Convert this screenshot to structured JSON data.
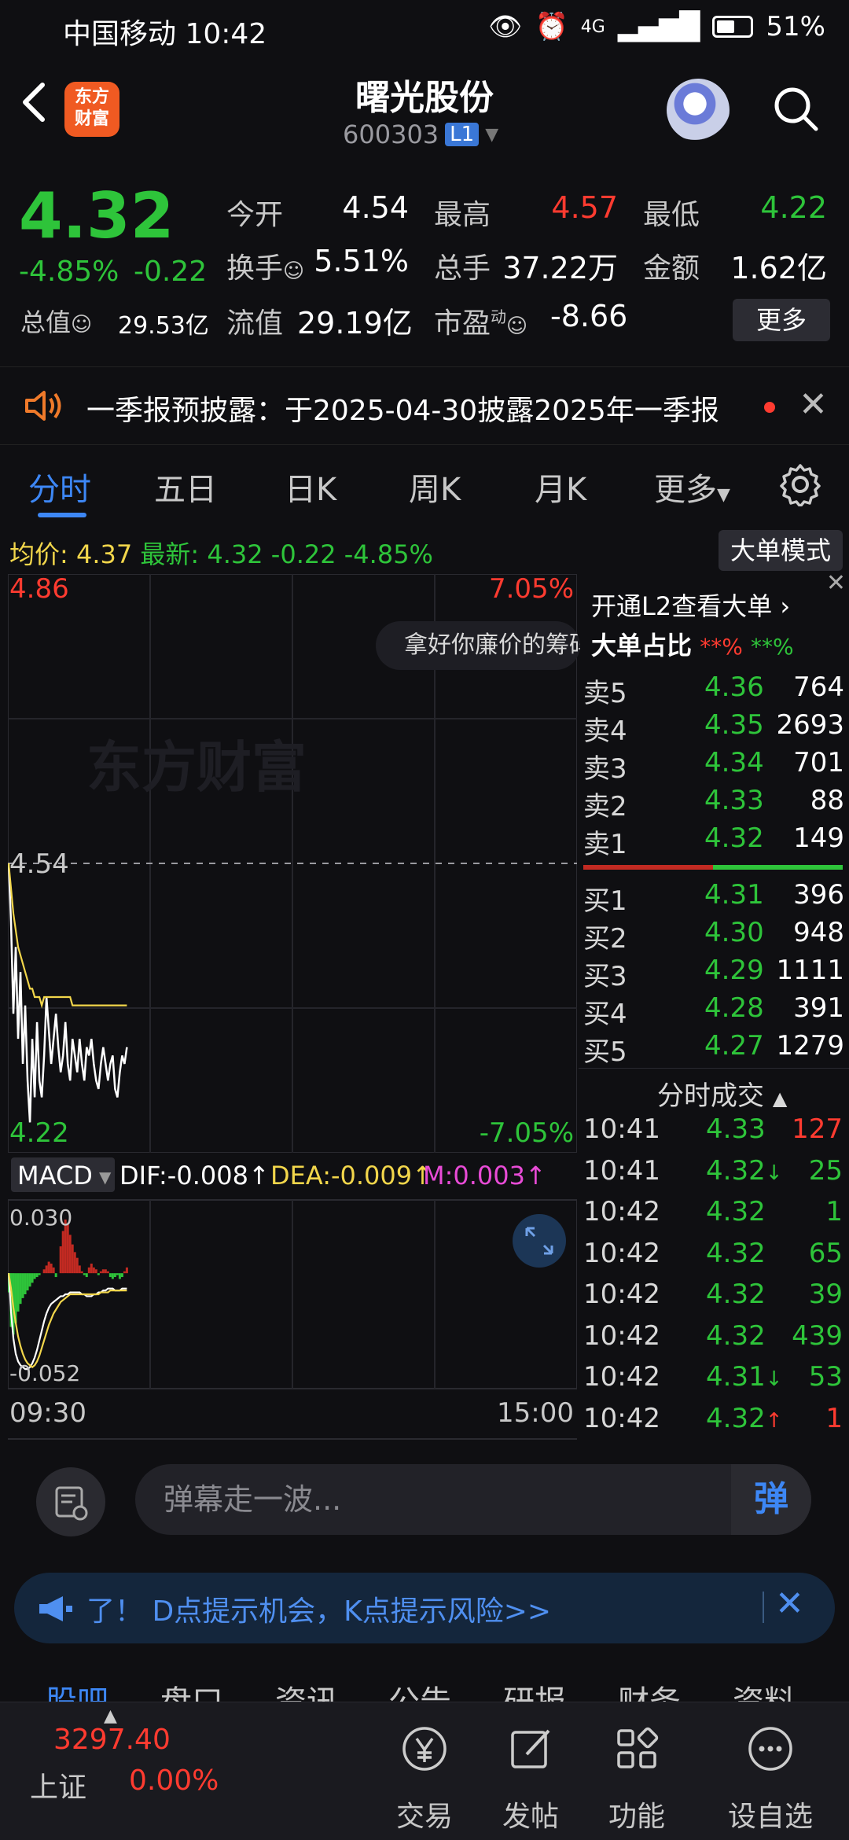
{
  "status_bar": {
    "carrier_time": "中国移动 10:42",
    "network": "4G",
    "battery": "51%"
  },
  "header": {
    "back_label": "<",
    "logo_text": [
      "东方",
      "财富"
    ],
    "title": "曙光股份",
    "code": "600303",
    "level_badge": "L1"
  },
  "quote": {
    "price": "4.32",
    "change_pct": "-4.85%",
    "change": "-0.22",
    "market_value_label": "总值",
    "market_value": "29.53亿",
    "fields": [
      {
        "label": "今开",
        "value": "4.54",
        "color": "#ffffff"
      },
      {
        "label": "最高",
        "value": "4.57",
        "color": "#ff3b30"
      },
      {
        "label": "最低",
        "value": "4.22",
        "color": "#2ec43a"
      },
      {
        "label": "换手",
        "value": "5.51%",
        "color": "#ffffff"
      },
      {
        "label": "总手",
        "value": "37.22万",
        "color": "#ffffff"
      },
      {
        "label": "金额",
        "value": "1.62亿",
        "color": "#ffffff"
      },
      {
        "label": "流值",
        "value": "29.19亿",
        "color": "#ffffff"
      },
      {
        "label": "市盈",
        "superscript": "动",
        "value": "-8.66",
        "color": "#ffffff"
      }
    ],
    "more_label": "更多"
  },
  "notice": {
    "text": "一季报预披露：于2025-04-30披露2025年一季报"
  },
  "tabs": {
    "items": [
      "分时",
      "五日",
      "日K",
      "周K",
      "月K",
      "更多"
    ],
    "active": "分时"
  },
  "info_line": {
    "avg_label": "均价:",
    "avg_value": "4.37",
    "latest_label": "最新:",
    "latest_value": "4.32",
    "latest_change": "-0.22",
    "latest_pct": "-4.85%",
    "big_order_mode": "大单模式"
  },
  "chart_data": [
    {
      "type": "line",
      "ylim": [
        4.22,
        4.86
      ],
      "y_ticks_left": [
        "4.86",
        "4.54",
        "4.22"
      ],
      "y_ticks_right": [
        "7.05%",
        "-7.05%"
      ],
      "x_ticks": [
        "09:30",
        "15:00"
      ],
      "reference_price": 4.54,
      "watermark": "东方财富",
      "series": [
        {
          "values": [
            4.54,
            4.47,
            4.36,
            4.44,
            4.33,
            4.41,
            4.3,
            4.37,
            4.28,
            4.23,
            4.33,
            4.26,
            4.35,
            4.28,
            4.26,
            4.31,
            4.38,
            4.34,
            4.3,
            4.33,
            4.36,
            4.32,
            4.29,
            4.31,
            4.35,
            4.3,
            4.28,
            4.33,
            4.31,
            4.29,
            4.33,
            4.3,
            4.28,
            4.32,
            4.31,
            4.33,
            4.3,
            4.28,
            4.27,
            4.3,
            4.32,
            4.3,
            4.28,
            4.3,
            4.31,
            4.27,
            4.26,
            4.29,
            4.31,
            4.3,
            4.32
          ],
          "color": "#ffffff"
        },
        {
          "values": [
            4.54,
            4.51,
            4.48,
            4.46,
            4.44,
            4.43,
            4.42,
            4.41,
            4.4,
            4.39,
            4.39,
            4.38,
            4.38,
            4.38,
            4.37,
            4.38,
            4.38,
            4.38,
            4.38,
            4.38,
            4.38,
            4.38,
            4.38,
            4.38,
            4.38,
            4.38,
            4.38,
            4.37,
            4.37,
            4.37,
            4.37,
            4.37,
            4.37,
            4.37,
            4.37,
            4.37,
            4.37,
            4.37,
            4.37,
            4.37,
            4.37,
            4.37,
            4.37,
            4.37,
            4.37,
            4.37,
            4.37,
            4.37,
            4.37,
            4.37,
            4.37
          ],
          "color": "#f2d64b"
        }
      ]
    },
    {
      "type": "bar",
      "indicator": "MACD",
      "ylim": [
        -0.052,
        0.03
      ],
      "y_ticks": [
        "0.030",
        "-0.052"
      ],
      "dif_label": "DIF:-0.008",
      "dea_label": "DEA:-0.009",
      "m_label": "M:0.003",
      "values": [
        -0.01,
        -0.028,
        -0.032,
        -0.026,
        -0.02,
        -0.016,
        -0.013,
        -0.011,
        -0.009,
        -0.007,
        -0.005,
        -0.003,
        -0.002,
        -0.001,
        0.0,
        0.002,
        0.004,
        0.006,
        0.005,
        0.003,
        -0.002,
        0.0,
        0.014,
        0.022,
        0.028,
        0.026,
        0.02,
        0.015,
        0.011,
        0.008,
        0.004,
        0.001,
        -0.001,
        -0.002,
        0.003,
        0.005,
        0.003,
        0.002,
        -0.001,
        0.001,
        0.002,
        0.002,
        0.001,
        -0.002,
        -0.003,
        -0.002,
        -0.001,
        -0.003,
        -0.002,
        0.001,
        0.003
      ],
      "series": [
        {
          "values": [
            0.0,
            -0.02,
            -0.034,
            -0.042,
            -0.046,
            -0.048,
            -0.049,
            -0.05,
            -0.05,
            -0.049,
            -0.047,
            -0.044,
            -0.04,
            -0.035,
            -0.03,
            -0.025,
            -0.021,
            -0.018,
            -0.016,
            -0.015,
            -0.014,
            -0.013,
            -0.012,
            -0.012,
            -0.011,
            -0.011,
            -0.01,
            -0.01,
            -0.01,
            -0.01,
            -0.01,
            -0.011,
            -0.011,
            -0.012,
            -0.012,
            -0.012,
            -0.011,
            -0.011,
            -0.01,
            -0.01,
            -0.009,
            -0.009,
            -0.008,
            -0.008,
            -0.008,
            -0.009,
            -0.009,
            -0.009,
            -0.008,
            -0.008,
            -0.008
          ],
          "color": "#ffffff"
        },
        {
          "values": [
            0.0,
            -0.008,
            -0.018,
            -0.026,
            -0.033,
            -0.038,
            -0.042,
            -0.045,
            -0.047,
            -0.048,
            -0.049,
            -0.048,
            -0.046,
            -0.043,
            -0.039,
            -0.035,
            -0.031,
            -0.027,
            -0.024,
            -0.021,
            -0.019,
            -0.017,
            -0.015,
            -0.014,
            -0.013,
            -0.012,
            -0.011,
            -0.011,
            -0.011,
            -0.011,
            -0.011,
            -0.011,
            -0.011,
            -0.011,
            -0.011,
            -0.011,
            -0.011,
            -0.011,
            -0.011,
            -0.01,
            -0.01,
            -0.01,
            -0.01,
            -0.009,
            -0.009,
            -0.009,
            -0.009,
            -0.009,
            -0.009,
            -0.009,
            -0.009
          ],
          "color": "#f2d64b"
        }
      ]
    }
  ],
  "chart_ui": {
    "promo_pill": "拿好你廉价的筹码",
    "macd_selector": "MACD"
  },
  "orderbook": {
    "l2_link": "开通L2查看大单",
    "big_ratio_label": "大单占比",
    "big_ratio_red": "**%",
    "big_ratio_green": "**%",
    "asks": [
      {
        "label": "卖5",
        "price": "4.36",
        "volume": "764"
      },
      {
        "label": "卖4",
        "price": "4.35",
        "volume": "2693"
      },
      {
        "label": "卖3",
        "price": "4.34",
        "volume": "701"
      },
      {
        "label": "卖2",
        "price": "4.33",
        "volume": "88"
      },
      {
        "label": "卖1",
        "price": "4.32",
        "volume": "149"
      }
    ],
    "bids": [
      {
        "label": "买1",
        "price": "4.31",
        "volume": "396"
      },
      {
        "label": "买2",
        "price": "4.30",
        "volume": "948"
      },
      {
        "label": "买3",
        "price": "4.29",
        "volume": "1111"
      },
      {
        "label": "买4",
        "price": "4.28",
        "volume": "391"
      },
      {
        "label": "买5",
        "price": "4.27",
        "volume": "1279"
      }
    ],
    "sell_buy_ratio": 0.5,
    "trades_header": "分时成交",
    "trades": [
      {
        "time": "10:41",
        "price": "4.33",
        "arrow": "",
        "volume": "127",
        "vol_color": "#ff3b30"
      },
      {
        "time": "10:41",
        "price": "4.32",
        "arrow": "↓",
        "volume": "25",
        "vol_color": "#2ec43a"
      },
      {
        "time": "10:42",
        "price": "4.32",
        "arrow": "",
        "volume": "1",
        "vol_color": "#2ec43a"
      },
      {
        "time": "10:42",
        "price": "4.32",
        "arrow": "",
        "volume": "65",
        "vol_color": "#2ec43a"
      },
      {
        "time": "10:42",
        "price": "4.32",
        "arrow": "",
        "volume": "39",
        "vol_color": "#2ec43a"
      },
      {
        "time": "10:42",
        "price": "4.32",
        "arrow": "",
        "volume": "439",
        "vol_color": "#2ec43a"
      },
      {
        "time": "10:42",
        "price": "4.31",
        "arrow": "↓",
        "volume": "53",
        "vol_color": "#2ec43a"
      },
      {
        "time": "10:42",
        "price": "4.32",
        "arrow": "↑",
        "volume": "1",
        "vol_color": "#ff3b30"
      }
    ]
  },
  "danmaku": {
    "placeholder": "弹幕走一波...",
    "send_label": "弹"
  },
  "banner": {
    "text": "了！ D点提示机会，K点提示风险>>"
  },
  "sub_tabs": [
    "股吧",
    "盘口",
    "资讯",
    "公告",
    "研报",
    "财务",
    "资料"
  ],
  "bottom_nav": {
    "index_name": "上证",
    "index_value": "3297.40",
    "index_pct": "0.00%",
    "items": [
      "交易",
      "发帖",
      "功能",
      "设自选"
    ]
  }
}
